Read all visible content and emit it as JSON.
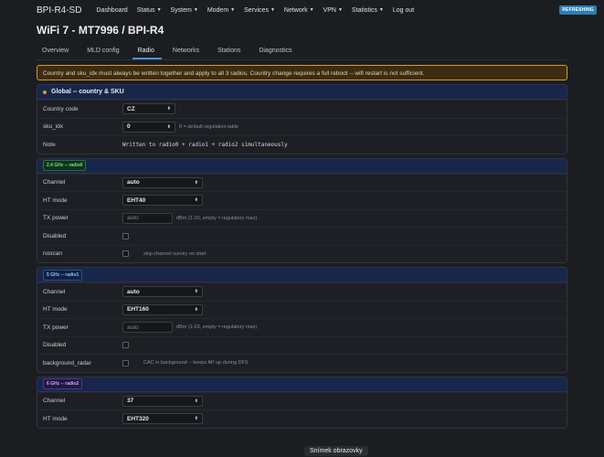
{
  "navbar": {
    "brand": "BPI-R4-SD",
    "menu": [
      {
        "label": "Dashboard",
        "caret": false
      },
      {
        "label": "Status",
        "caret": true
      },
      {
        "label": "System",
        "caret": true
      },
      {
        "label": "Modem",
        "caret": true
      },
      {
        "label": "Services",
        "caret": true
      },
      {
        "label": "Network",
        "caret": true
      },
      {
        "label": "VPN",
        "caret": true
      },
      {
        "label": "Statistics",
        "caret": true
      },
      {
        "label": "Log out",
        "caret": false
      }
    ],
    "refresh_badge": "REFRESHING"
  },
  "page_title": "WiFi 7 - MT7996 / BPI-R4",
  "tabs": [
    "Overview",
    "MLD config",
    "Radio",
    "Networks",
    "Stations",
    "Diagnostics"
  ],
  "active_tab": "Radio",
  "warning": "Country and sku_idx must always be written together and apply to all 3 radios. Country change requires a full reboot -- wifi restart is not sufficient.",
  "global": {
    "title": "Global -- country & SKU",
    "country_label": "Country code",
    "country_value": "CZ",
    "sku_label": "sku_idx",
    "sku_value": "0",
    "sku_hint": "0 = default regulation table",
    "note_label": "Note",
    "note_value": "Written to radio0 + radio1 + radio2 simultaneously"
  },
  "radio0": {
    "badge": "2.4 GHz -- radio0",
    "channel_label": "Channel",
    "channel_value": "auto",
    "htmode_label": "HT mode",
    "htmode_value": "EHT40",
    "txpower_label": "TX power",
    "txpower_placeholder": "auto",
    "txpower_hint": "dBm (1-20, empty = regulatory max)",
    "disabled_label": "Disabled",
    "noscan_label": "noscan",
    "noscan_hint": "skip channel survey on start"
  },
  "radio1": {
    "badge": "5 GHz -- radio1",
    "channel_label": "Channel",
    "channel_value": "auto",
    "htmode_label": "HT mode",
    "htmode_value": "EHT160",
    "txpower_label": "TX power",
    "txpower_placeholder": "auto",
    "txpower_hint": "dBm (1-23, empty = regulatory max)",
    "disabled_label": "Disabled",
    "bgradar_label": "background_radar",
    "bgradar_hint": "CAC in background -- keeps AP up during DFS"
  },
  "radio2": {
    "badge": "6 GHz -- radio2",
    "channel_label": "Channel",
    "channel_value": "37",
    "htmode_label": "HT mode",
    "htmode_value": "EHT320"
  },
  "screenshot_label": "Snímek obrazovky",
  "colors": {
    "accent": "#4a90d9",
    "warning_border": "#d49a2f",
    "section_header": "#17264a"
  }
}
